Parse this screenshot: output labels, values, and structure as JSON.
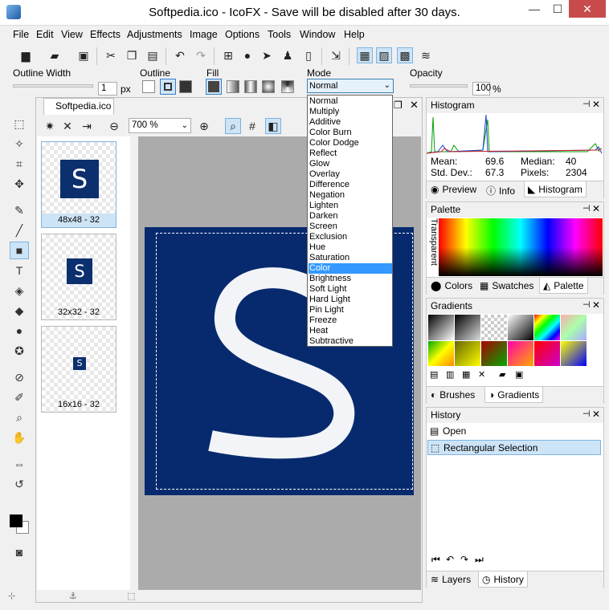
{
  "window": {
    "title": "Softpedia.ico - IcoFX - Save will be disabled after 30 days.",
    "minimize": "—",
    "maximize": "☐",
    "close": "✕"
  },
  "menu": [
    "File",
    "Edit",
    "View",
    "Effects",
    "Adjustments",
    "Image",
    "Options",
    "Tools",
    "Window",
    "Help"
  ],
  "options": {
    "outline_width_label": "Outline Width",
    "outline_width_value": "1",
    "outline_width_unit": "px",
    "outline_label": "Outline",
    "fill_label": "Fill",
    "mode_label": "Mode",
    "mode_value": "Normal",
    "opacity_label": "Opacity",
    "opacity_value": "100",
    "opacity_unit": "%"
  },
  "mode_options": [
    "Normal",
    "Multiply",
    "Additive",
    "Color Burn",
    "Color Dodge",
    "Reflect",
    "Glow",
    "Overlay",
    "Difference",
    "Negation",
    "Lighten",
    "Darken",
    "Screen",
    "Exclusion",
    "Hue",
    "Saturation",
    "Color",
    "Brightness",
    "Soft Light",
    "Hard Light",
    "Pin Light",
    "Freeze",
    "Heat",
    "Subtractive"
  ],
  "mode_highlighted": "Color",
  "document": {
    "tab_label": "Softpedia.ico",
    "zoom": "700 %",
    "thumbnails": [
      {
        "label": "48x48 - 32",
        "selected": true
      },
      {
        "label": "32x32 - 32",
        "selected": false
      },
      {
        "label": "16x16 - 32",
        "selected": false
      }
    ],
    "icon_letter": "S"
  },
  "histogram": {
    "title": "Histogram",
    "mean_label": "Mean:",
    "mean": "69.6",
    "median_label": "Median:",
    "median": "40",
    "stddev_label": "Std. Dev.:",
    "stddev": "67.3",
    "pixels_label": "Pixels:",
    "pixels": "2304",
    "tabs": [
      "Preview",
      "Info",
      "Histogram"
    ]
  },
  "palette": {
    "title": "Palette",
    "transparent_label": "Transparent",
    "tabs": [
      "Colors",
      "Swatches",
      "Palette"
    ]
  },
  "gradients": {
    "title": "Gradients",
    "tabs": [
      "Brushes",
      "Gradients"
    ]
  },
  "history": {
    "title": "History",
    "items": [
      "Open",
      "Rectangular Selection"
    ],
    "tabs": [
      "Layers",
      "History"
    ]
  },
  "colors": {
    "accent": "#3399ff",
    "icon_bg": "#0c2f6e",
    "selection": "#cde4f7"
  },
  "icons": {
    "file_toolbar": [
      "new-icon",
      "open-icon",
      "save-icon",
      "cut-icon",
      "copy-icon",
      "paste-icon",
      "undo-icon",
      "redo-icon",
      "windows-icon",
      "apple-icon",
      "cursor-icon",
      "android-icon",
      "mobile-icon",
      "import-icon",
      "checker-icon",
      "mask-icon",
      "grid-icon",
      "layers-icon"
    ],
    "left_tools": [
      "marquee-icon",
      "magic-wand-icon",
      "crop-icon",
      "move-icon",
      "brush-icon",
      "line-icon",
      "rectangle-icon",
      "text-icon",
      "fill-icon",
      "eraser-icon",
      "drop-icon",
      "bulb-icon",
      "eyedropper-icon",
      "pencil-icon",
      "zoom-icon",
      "hand-icon",
      "flip-icon",
      "rotate-icon"
    ]
  }
}
